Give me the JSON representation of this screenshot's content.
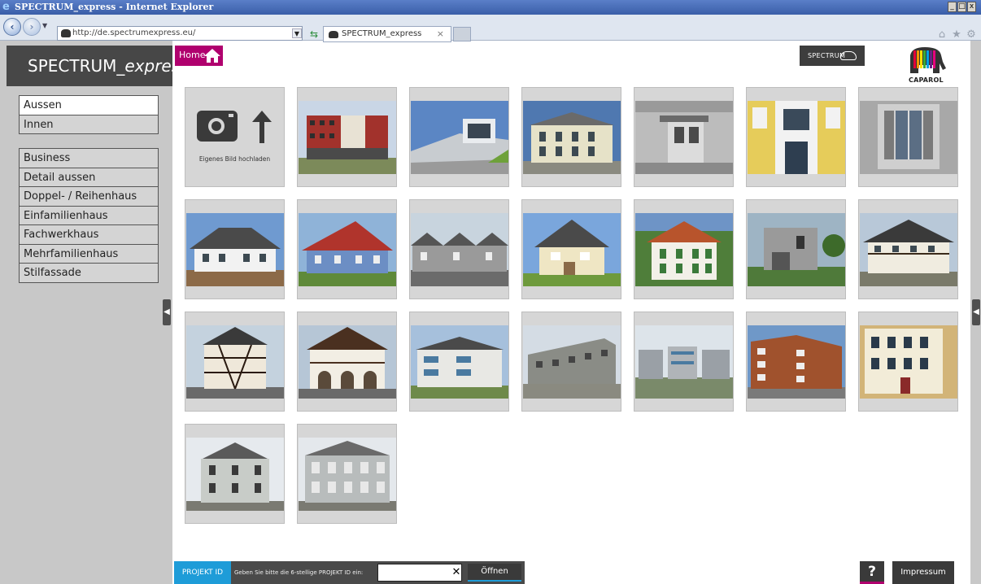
{
  "browser": {
    "window_title": "SPECTRUM_express - Internet Explorer",
    "address": "http://de.spectrumexpress.eu/",
    "tab_title": "SPECTRUM_express"
  },
  "app": {
    "brand_prefix": "SPECTRUM_",
    "brand_suffix": "express",
    "home_label": "Home",
    "spectrum_logo": "SPECTRUM",
    "caparol_logo": "CAPAROL"
  },
  "sidebar": {
    "location_items": [
      {
        "label": "Aussen",
        "active": true
      },
      {
        "label": "Innen",
        "active": false
      }
    ],
    "category_items": [
      {
        "label": "Business"
      },
      {
        "label": "Detail aussen"
      },
      {
        "label": "Doppel- / Reihenhaus"
      },
      {
        "label": "Einfamilienhaus"
      },
      {
        "label": "Fachwerkhaus"
      },
      {
        "label": "Mehrfamilienhaus"
      },
      {
        "label": "Stilfassade"
      }
    ]
  },
  "gallery": {
    "upload_label": "Eigenes Bild hochladen"
  },
  "footer": {
    "projekt_tag": "PROJEKT ID",
    "projekt_hint": "Geben Sie bitte die 6-stellige PROJEKT ID ein:",
    "projekt_value": "",
    "open_label": "Öffnen",
    "help_label": "?",
    "impressum_label": "Impressum"
  },
  "colors": {
    "accent_magenta": "#b0006e",
    "accent_blue": "#1e9cd8",
    "sidebar_bg": "#c8c8c8",
    "brand_bg": "#474747"
  }
}
